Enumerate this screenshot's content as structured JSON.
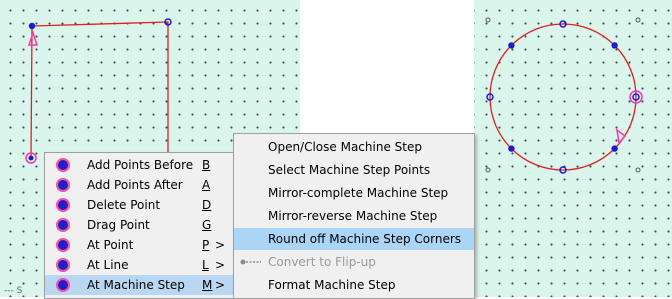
{
  "app": {
    "status_fragment": "--- S"
  },
  "context_menu": {
    "items": [
      {
        "label": "Add Points Before",
        "key": "B",
        "arrow": ""
      },
      {
        "label": "Add Points After",
        "key": "A",
        "arrow": ""
      },
      {
        "label": "Delete Point",
        "key": "D",
        "arrow": ""
      },
      {
        "label": "Drag Point",
        "key": "G",
        "arrow": ""
      },
      {
        "label": "At Point",
        "key": "P",
        "arrow": ">"
      },
      {
        "label": "At Line",
        "key": "L",
        "arrow": ">"
      },
      {
        "label": "At Machine Step",
        "key": "M",
        "arrow": ">"
      }
    ],
    "selected_index": 6,
    "bullet_color": "#2020c8",
    "bullet_ring_color": "#ff4fa0"
  },
  "submenu": {
    "items": [
      {
        "label": "Open/Close Machine Step"
      },
      {
        "label": "Select Machine Step Points"
      },
      {
        "label": "Mirror-complete Machine Step"
      },
      {
        "label": "Mirror-reverse Machine Step"
      },
      {
        "label": "Round off Machine Step Corners"
      },
      {
        "label": "Convert to Flip-up",
        "icon": "flip-up-icon",
        "disabled": true
      },
      {
        "label": "Format Machine Step"
      }
    ],
    "selected_index": 4
  },
  "colors": {
    "canvas_bg": "#d9f5ec",
    "path_stroke": "#e02020",
    "point_fill": "#1a1ad0",
    "marker": "#ff33aa",
    "menu_bg": "#f0f0f0",
    "highlight": "#aad5f7"
  }
}
